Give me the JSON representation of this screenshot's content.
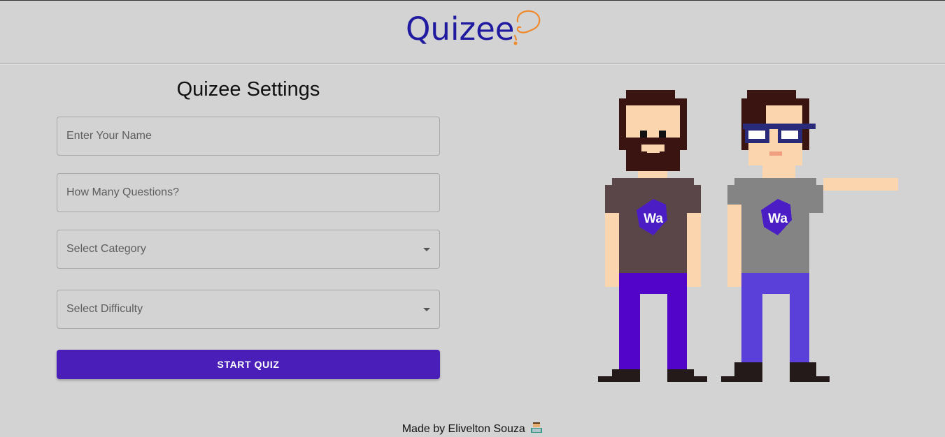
{
  "header": {
    "logo_text": "Quizee",
    "brand_color": "#1f1aa0",
    "mark_color": "#f08a2e"
  },
  "settings": {
    "title": "Quizee Settings",
    "name_placeholder": "Enter Your Name",
    "questions_placeholder": "How Many Questions?",
    "category_label": "Select Category",
    "difficulty_label": "Select Difficulty",
    "start_button": "START QUIZ",
    "button_color": "#4a1eb8"
  },
  "illustration": {
    "left_badge": "Wa",
    "right_badge": "Wa"
  },
  "footer": {
    "credit": "Made by Elivelton Souza"
  }
}
